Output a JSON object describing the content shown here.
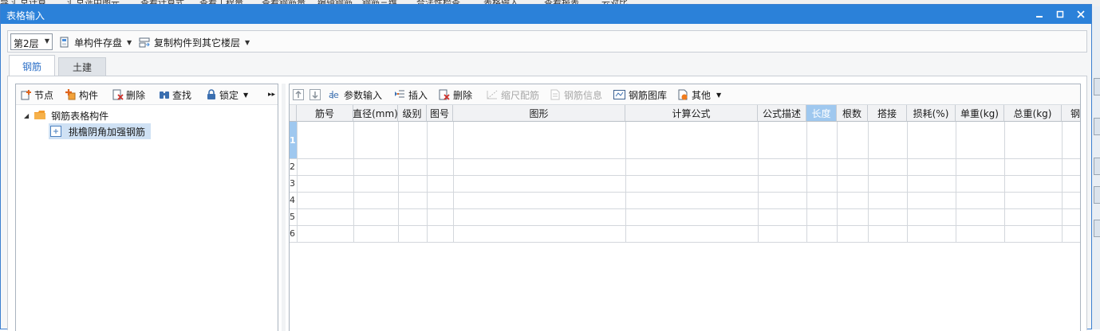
{
  "background_menu": [
    "导",
    "汇总计算",
    "汇总选中图元",
    "查看计算式",
    "查看工程量",
    "查看钢筋量",
    "编辑钢筋",
    "钢筋三维",
    "合法性检查",
    "表格输入",
    "查看报表",
    "云对比"
  ],
  "window": {
    "title": "表格输入"
  },
  "window_controls": {
    "minimize": "▬",
    "maximize": "□",
    "close": "✕"
  },
  "toolbar": {
    "floor": "第2层",
    "save_component": "单构件存盘",
    "copy_to_floor": "复制构件到其它楼层"
  },
  "tabs": [
    {
      "label": "钢筋",
      "active": true
    },
    {
      "label": "土建",
      "active": false
    }
  ],
  "left_toolbar": {
    "node": "节点",
    "component": "构件",
    "delete": "删除",
    "find": "查找",
    "lock": "锁定",
    "more": "▸▸"
  },
  "tree": {
    "root": "钢筋表格构件",
    "child": "挑檐阴角加强钢筋"
  },
  "grid_toolbar": {
    "param_input": "参数输入",
    "insert": "插入",
    "delete": "删除",
    "scale_rebar": "缩尺配筋",
    "rebar_info": "钢筋信息",
    "rebar_library": "钢筋图库",
    "other": "其他"
  },
  "grid": {
    "columns": [
      "筋号",
      "直径(mm)",
      "级别",
      "图号",
      "图形",
      "计算公式",
      "公式描述",
      "长度",
      "根数",
      "搭接",
      "损耗(%)",
      "单重(kg)",
      "总重(kg)",
      "钢"
    ],
    "selected_column": "长度",
    "rows": [
      "1",
      "2",
      "3",
      "4",
      "5",
      "6"
    ],
    "selected_row": "1"
  },
  "colors": {
    "titlebar": "#2b81d9",
    "selection": "#9fc8ef",
    "active_tab_text": "#2b6fc7"
  }
}
